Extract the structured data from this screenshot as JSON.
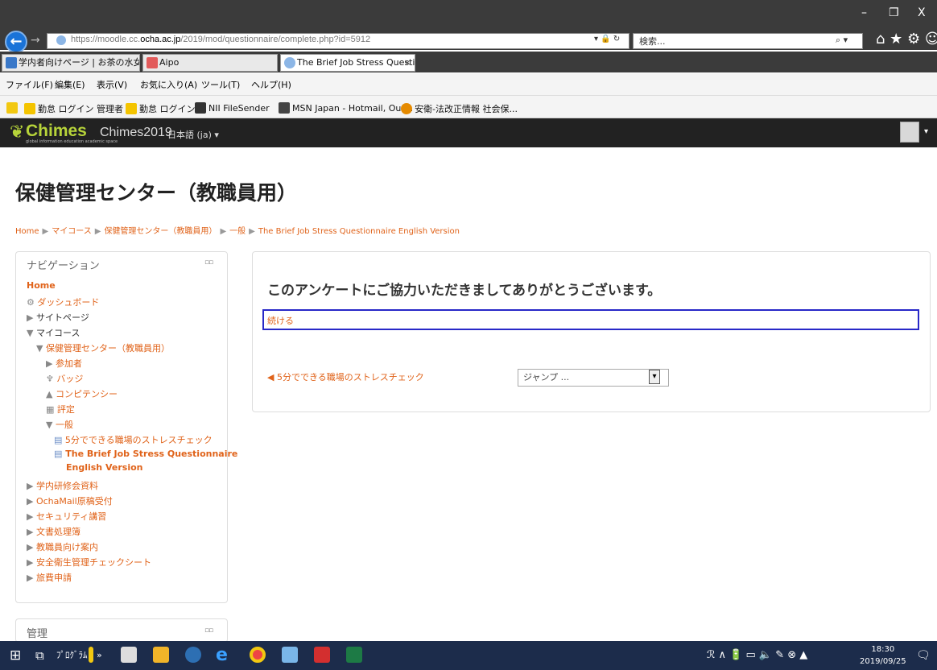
{
  "browser": {
    "url_prefix": "https://moodle.cc.",
    "url_domain": "ocha.ac.jp",
    "url_path": "/2019/mod/questionnaire/complete.php?id=5912",
    "url_tools": "▾ 🔒 ↻",
    "search_placeholder": "検索...",
    "search_icon": "⌕ ▾",
    "back_glyph": "←",
    "forward_glyph": "→",
    "toolbar_icons": "⌂ ★ ⚙ ☺",
    "window_controls": [
      "–",
      "❐",
      "X"
    ],
    "tabs": [
      {
        "label": "学内者向けページ | お茶の水女子..."
      },
      {
        "label": "Aipo"
      },
      {
        "label": "The Brief Job Stress Questio...",
        "close": "×"
      }
    ],
    "menu": [
      "ファイル(F)",
      "編集(E)",
      "表示(V)",
      "お気に入り(A)",
      "ツール(T)",
      "ヘルプ(H)"
    ],
    "favorites": [
      "勤怠 ログイン 管理者",
      "勤怠 ログイン",
      "NII FileSender",
      "MSN Japan - Hotmail, Out...",
      "安衛-法改正情報 社会保..."
    ]
  },
  "moodle_nav": {
    "logo_text": "Chimes",
    "logo_sub": "global   information   education   academic   space",
    "site_name": "Chimes2019",
    "language": "日本語 (ja) ▾",
    "user_caret": "▾"
  },
  "page": {
    "title": "保健管理センター（教職員用）",
    "breadcrumb": [
      "Home",
      "マイコース",
      "保健管理センター（教職員用）",
      "一般",
      "The Brief Job Stress Questionnaire English Version"
    ],
    "breadcrumb_sep": "▶"
  },
  "navigation": {
    "title": "ナビゲーション",
    "controls": "▫▫",
    "items": [
      {
        "label": "Home"
      },
      {
        "label": "ダッシュボード"
      },
      {
        "label": "サイトページ"
      },
      {
        "label": "マイコース"
      },
      {
        "label": "保健管理センター（教職員用）"
      },
      {
        "label": "参加者"
      },
      {
        "label": "バッジ"
      },
      {
        "label": "コンピテンシー"
      },
      {
        "label": "評定"
      },
      {
        "label": "一般"
      },
      {
        "label": "5分でできる職場のストレスチェック"
      },
      {
        "label": "The Brief Job Stress Questionnaire"
      },
      {
        "label": "English Version"
      },
      {
        "label": "学内研修会資料"
      },
      {
        "label": "OchaMail原稿受付"
      },
      {
        "label": "セキュリティ講習"
      },
      {
        "label": "文書処理簿"
      },
      {
        "label": "教職員向け案内"
      },
      {
        "label": "安全衛生管理チェックシート"
      },
      {
        "label": "旅費申請"
      }
    ]
  },
  "manage_block": {
    "title": "管理",
    "controls": "▫▫"
  },
  "main": {
    "thanks": "このアンケートにご協力いただきましてありがとうございます。",
    "continue": "続ける",
    "prev_link": "◀ 5分でできる職場のストレスチェック",
    "jump_placeholder": "ジャンプ ...",
    "jump_caret": "▾"
  },
  "taskbar": {
    "start": "⊞",
    "task_view": "⧉",
    "programs": "ﾌﾟﾛｸﾞﾗﾑ",
    "programs_more": "»",
    "tray": "ℛ  ∧ 🔋 ▭ 🔈 ✎ ⊗ ▲",
    "time": "18:30",
    "date": "2019/09/25",
    "notifications": "🗨"
  },
  "colors": {
    "accent_link": "#e0631a",
    "nav_bg": "#222222",
    "taskbar_bg": "#1c2c4b"
  }
}
